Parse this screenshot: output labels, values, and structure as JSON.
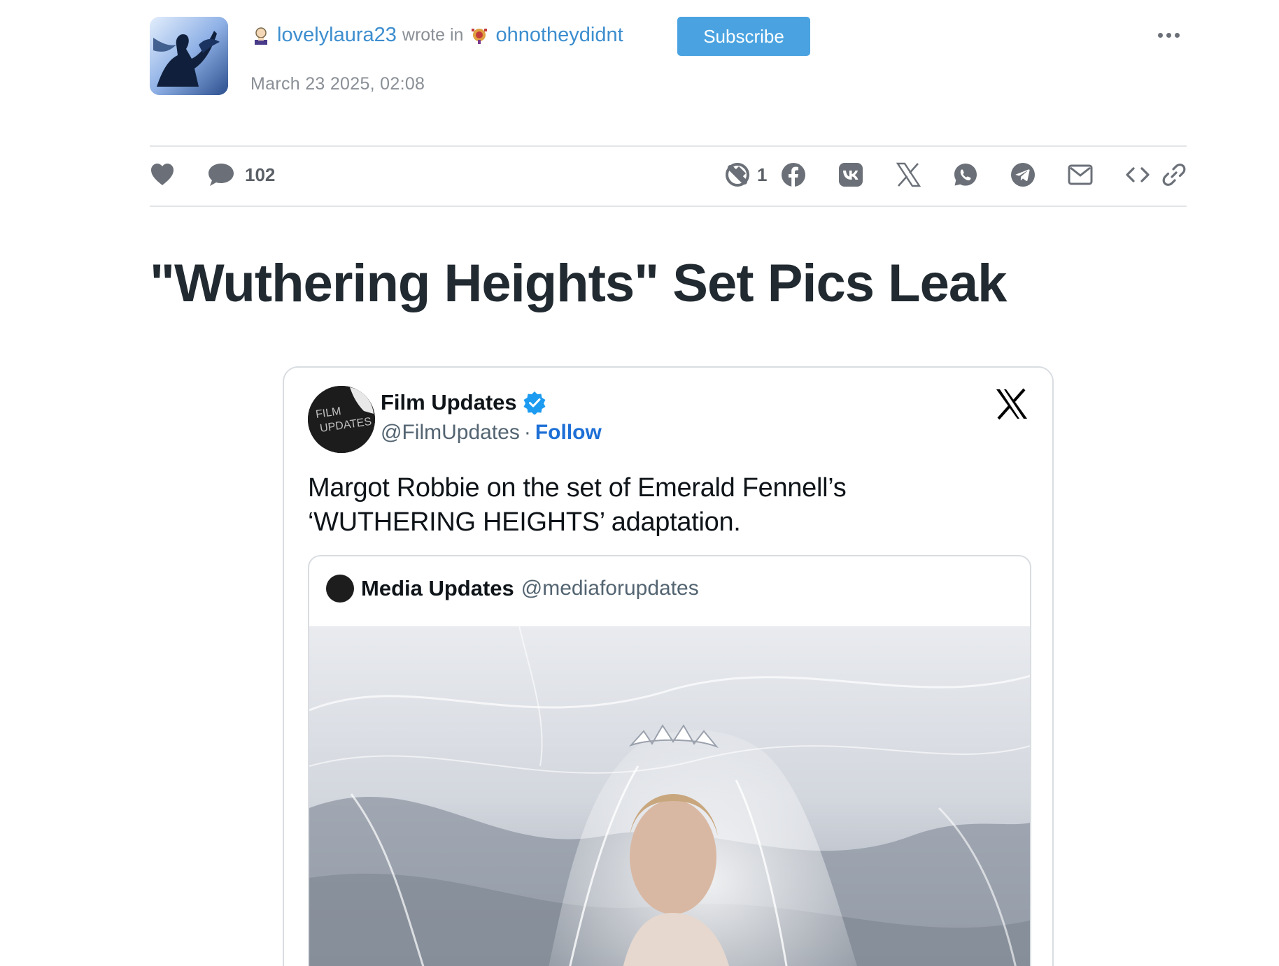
{
  "post": {
    "author": "lovelylaura23",
    "wrote_in": "wrote in",
    "community": "ohnotheydidnt",
    "subscribe_label": "Subscribe",
    "date": "March 23 2025, 02:08",
    "title": "\"Wuthering Heights\" Set Pics Leak"
  },
  "actions": {
    "comment_count": "102",
    "repost_count": "1",
    "icons": [
      "heart-icon",
      "comment-icon",
      "repost-icon",
      "facebook-icon",
      "vk-icon",
      "x-icon",
      "whatsapp-icon",
      "telegram-icon",
      "email-icon",
      "embed-icon",
      "link-icon"
    ]
  },
  "tweet": {
    "avatar_text_line1": "FILM",
    "avatar_text_line2": "UPDATES",
    "name": "Film Updates",
    "handle": "@FilmUpdates",
    "separator": "·",
    "follow_label": "Follow",
    "text_line1": "Margot Robbie on the set of Emerald Fennell’s",
    "text_line2": "‘WUTHERING HEIGHTS’ adaptation.",
    "quoted": {
      "name": "Media Updates",
      "handle": "@mediaforupdates"
    }
  },
  "colors": {
    "link": "#3d8ecf",
    "subscribe_bg": "#4aa3e0",
    "title": "#222a31",
    "follow": "#1d6fd6",
    "verified": "#1d9bf0"
  }
}
